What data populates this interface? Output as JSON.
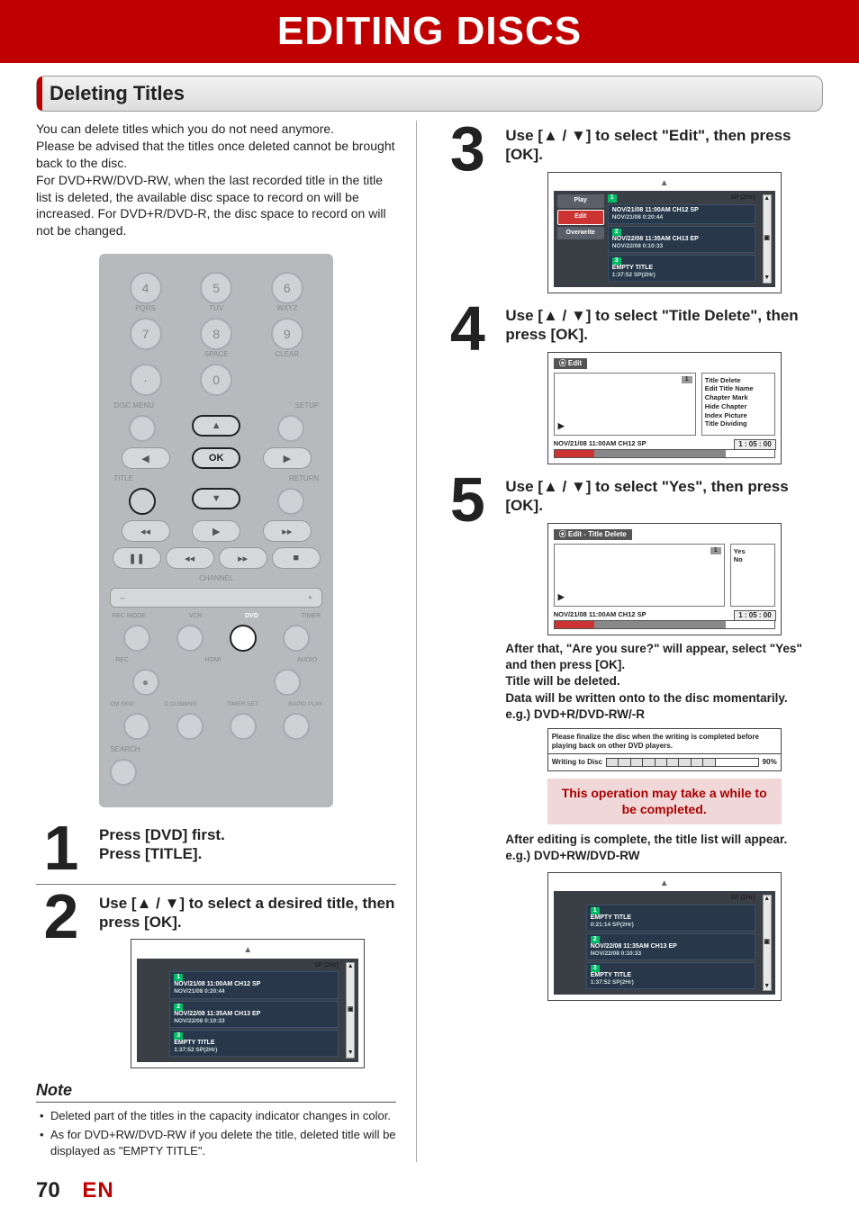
{
  "page": {
    "banner": "EDITING DISCS",
    "section": "Deleting Titles",
    "page_number": "70",
    "lang": "EN"
  },
  "intro": {
    "l1": "You can delete titles which you do not need anymore.",
    "l2": "Please be advised that the titles once deleted cannot be brought back to the disc.",
    "l3": "For DVD+RW/DVD-RW, when the last recorded title in the title list is deleted, the available disc space to record on will be increased. For DVD+R/DVD-R, the disc space to record on will not be changed."
  },
  "remote": {
    "keys": {
      "k4": "4",
      "k5": "5",
      "k6": "6",
      "k7": "7",
      "k8": "8",
      "k9": "9",
      "k0": "0",
      "dot": "·"
    },
    "labels": {
      "pqrs": "PQRS",
      "tuv": "TUV",
      "wxyz": "WXYZ",
      "space": "SPACE",
      "clear": "CLEAR",
      "discmenu": "DISC MENU",
      "setup": "SETUP",
      "ok": "OK",
      "title": "TITLE",
      "return": "RETURN",
      "channel": "CHANNEL",
      "minus": "–",
      "plus": "+",
      "recmode": "REC MODE",
      "vcr": "VCR",
      "dvd": "DVD",
      "timer": "TIMER",
      "rec": "REC",
      "hdmi": "HDMI",
      "audio": "AUDIO",
      "cmskip": "CM SKIP",
      "ddubbing": "D.DUBBING",
      "timerset": "TIMER SET",
      "rapidplay": "RAPID PLAY",
      "search": "SEARCH"
    }
  },
  "step1": {
    "num": "1",
    "l1": "Press [DVD] first.",
    "l2": "Press [TITLE]."
  },
  "step2": {
    "num": "2",
    "text": "Use [▲ / ▼] to select a desired title, then press [OK].",
    "list": {
      "mode": "SP (2Hr)",
      "r1": {
        "n": "1",
        "a": "NOV/21/08  11:00AM CH12  SP",
        "b": "NOV/21/08   0:20:44"
      },
      "r2": {
        "n": "2",
        "a": "NOV/22/08  11:35AM CH13  EP",
        "b": "NOV/22/08   0:10:33"
      },
      "r3": {
        "n": "3",
        "a": "EMPTY TITLE",
        "b": "1:37:52  SP(2Hr)"
      }
    }
  },
  "note": {
    "head": "Note",
    "n1": "Deleted part of the titles in the capacity indicator changes in color.",
    "n2": "As for DVD+RW/DVD-RW if you delete the title, deleted title will be displayed as \"EMPTY TITLE\"."
  },
  "step3": {
    "num": "3",
    "text": "Use [▲ / ▼] to select \"Edit\", then press [OK].",
    "side": {
      "play": "Play",
      "edit": "Edit",
      "overwrite": "Overwrite"
    },
    "list": {
      "mode": "SP (2Hr)",
      "r1": {
        "n": "1",
        "a": "NOV/21/08  11:00AM CH12  SP",
        "b": "NOV/21/08   0:20:44"
      },
      "r2": {
        "n": "2",
        "a": "NOV/22/08  11:35AM CH13  EP",
        "b": "NOV/22/08   0:10:33"
      },
      "r3": {
        "n": "3",
        "a": "EMPTY TITLE",
        "b": "1:37:52  SP(2Hr)"
      }
    }
  },
  "step4": {
    "num": "4",
    "text": "Use [▲ / ▼] to select \"Title Delete\", then press [OK].",
    "title": "Edit",
    "items": {
      "i1": "Title Delete",
      "i2": "Edit Title Name",
      "i3": "Chapter Mark",
      "i4": "Hide Chapter",
      "i5": "Index Picture",
      "i6": "Title Dividing"
    },
    "meta": "NOV/21/08 11:00AM CH12 SP",
    "badge": "1",
    "time": "1 : 05 : 00"
  },
  "step5": {
    "num": "5",
    "text": "Use [▲ / ▼] to select \"Yes\", then press [OK].",
    "title": "Edit - Title Delete",
    "yes": "Yes",
    "no": "No",
    "meta": "NOV/21/08 11:00AM CH12 SP",
    "badge": "1",
    "time": "1 : 05 : 00",
    "after": {
      "l1": "After that, \"Are you sure?\" will appear, select \"Yes\" and then press ",
      "ok": "[OK]",
      "l1b": ".",
      "l2": "Title will be deleted.",
      "l3": "Data will be written onto to the disc momentarily.",
      "l4": "e.g.) DVD+R/DVD-RW/-R"
    },
    "finalize": {
      "msg": "Please finalize the disc when the writing is completed before playing back on other DVD players.",
      "label": "Writing to Disc",
      "pct": "90%"
    },
    "callout": "This operation may take a while to be completed.",
    "after2": {
      "l1": "After editing is complete, the title list will appear.",
      "l2": "e.g.) DVD+RW/DVD-RW"
    },
    "list2": {
      "mode": "SP (2Hr)",
      "r1": {
        "n": "1",
        "a": "EMPTY TITLE",
        "b": "0:21:14  SP(2Hr)"
      },
      "r2": {
        "n": "2",
        "a": "NOV/22/08  11:35AM CH13  EP",
        "b": "NOV/22/08   0:10:33"
      },
      "r3": {
        "n": "3",
        "a": "EMPTY TITLE",
        "b": "1:37:52  SP(2Hr)"
      }
    }
  }
}
